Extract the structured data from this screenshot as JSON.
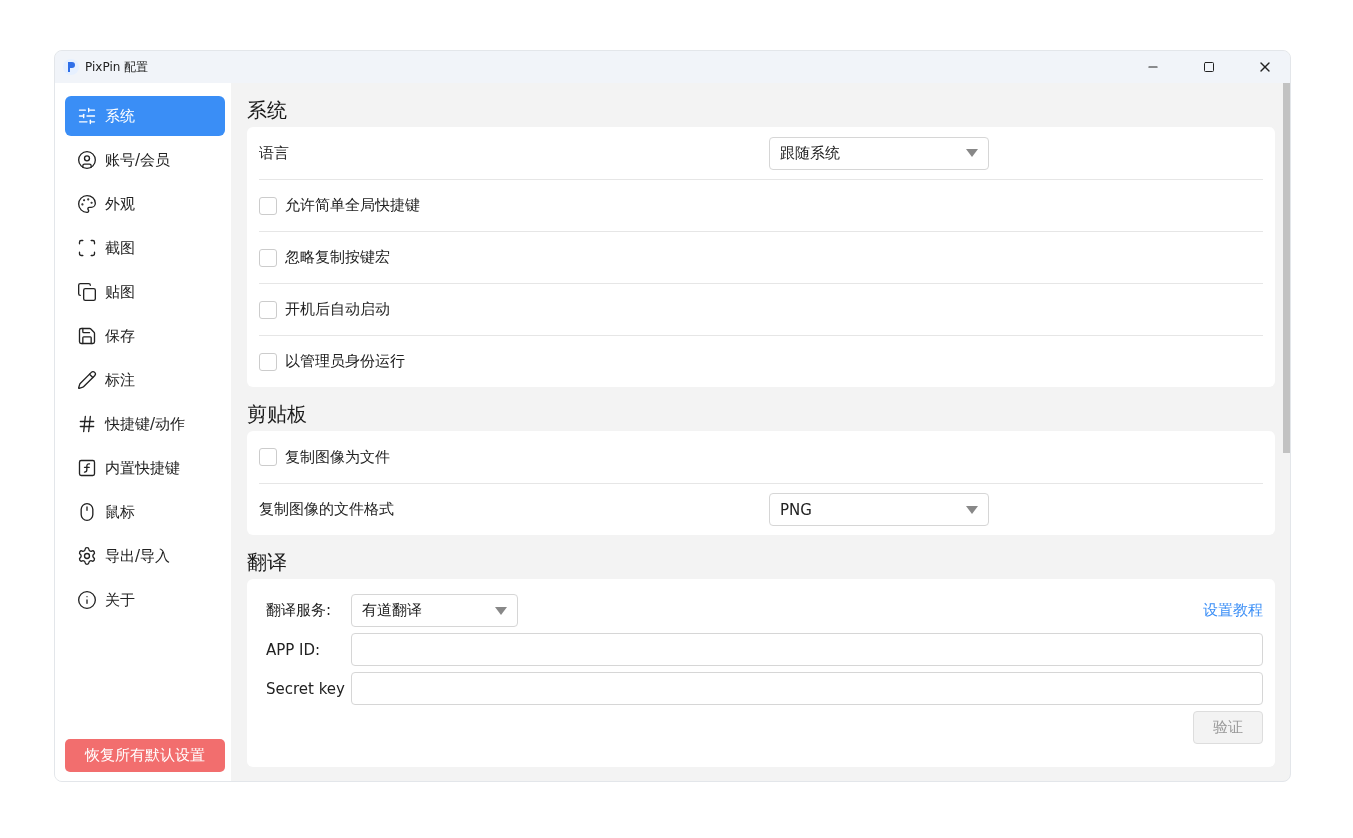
{
  "window": {
    "title": "PixPin 配置"
  },
  "sidebar": {
    "items": [
      {
        "label": "系统",
        "selected": true
      },
      {
        "label": "账号/会员",
        "selected": false
      },
      {
        "label": "外观",
        "selected": false
      },
      {
        "label": "截图",
        "selected": false
      },
      {
        "label": "贴图",
        "selected": false
      },
      {
        "label": "保存",
        "selected": false
      },
      {
        "label": "标注",
        "selected": false
      },
      {
        "label": "快捷键/动作",
        "selected": false
      },
      {
        "label": "内置快捷键",
        "selected": false
      },
      {
        "label": "鼠标",
        "selected": false
      },
      {
        "label": "导出/导入",
        "selected": false
      },
      {
        "label": "关于",
        "selected": false
      }
    ],
    "reset_button": "恢复所有默认设置"
  },
  "sections": [
    {
      "title": "系统",
      "rows": [
        {
          "kind": "select",
          "label": "语言",
          "value": "跟随系统"
        },
        {
          "kind": "checkbox",
          "label": "允许简单全局快捷键",
          "checked": false
        },
        {
          "kind": "checkbox",
          "label": "忽略复制按键宏",
          "checked": false
        },
        {
          "kind": "checkbox",
          "label": "开机后自动启动",
          "checked": false
        },
        {
          "kind": "checkbox",
          "label": "以管理员身份运行",
          "checked": false
        }
      ]
    },
    {
      "title": "剪贴板",
      "rows": [
        {
          "kind": "checkbox",
          "label": "复制图像为文件",
          "checked": false
        },
        {
          "kind": "select",
          "label": "复制图像的文件格式",
          "value": "PNG"
        }
      ]
    }
  ],
  "translation": {
    "title": "翻译",
    "service_label": "翻译服务:",
    "service_value": "有道翻译",
    "tutorial_link": "设置教程",
    "app_id_label": "APP ID:",
    "secret_key_label": "Secret key",
    "verify_button": {
      "label": "验证",
      "disabled": true
    }
  }
}
